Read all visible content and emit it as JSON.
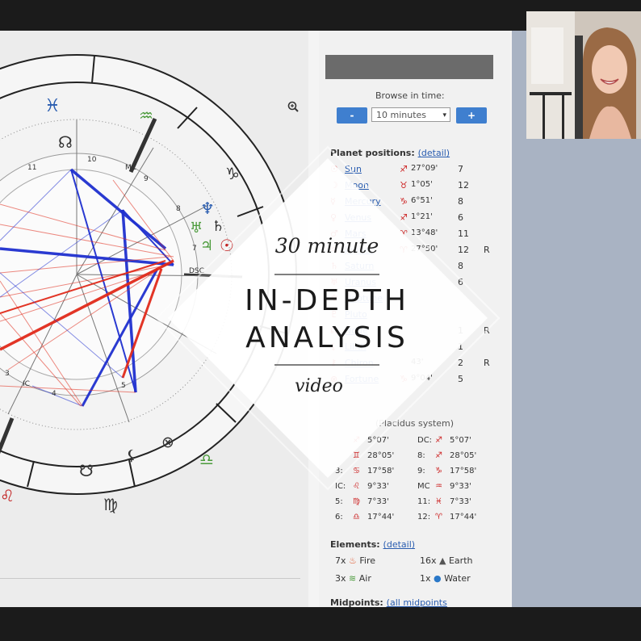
{
  "overlay": {
    "top_script": "30 minute",
    "headline_line1": "IN-DEPTH",
    "headline_line2": "ANALYSIS",
    "bottom_script": "video"
  },
  "panel": {
    "browse_label": "Browse in time:",
    "minus_label": "-",
    "plus_label": "+",
    "interval_value": "10 minutes",
    "planet_title": "Planet positions:",
    "planet_detail": "(detail)",
    "planets": [
      {
        "glyph": "☉",
        "name": "Sun",
        "sign": "♐",
        "degree": "27°09'",
        "house": "7",
        "retro": ""
      },
      {
        "glyph": "☽",
        "name": "Moon",
        "sign": "♉",
        "degree": "1°05'",
        "house": "12",
        "retro": ""
      },
      {
        "glyph": "☿",
        "name": "Mercury",
        "sign": "♑",
        "degree": "6°51'",
        "house": "8",
        "retro": ""
      },
      {
        "glyph": "♀",
        "name": "Venus",
        "sign": "♐",
        "degree": "1°21'",
        "house": "6",
        "retro": ""
      },
      {
        "glyph": "♂",
        "name": "Mars",
        "sign": "♈",
        "degree": "13°48'",
        "house": "11",
        "retro": ""
      },
      {
        "glyph": "♃",
        "name": "Jupiter",
        "sign": "♈",
        "degree": "27°50'",
        "house": "12",
        "retro": "R"
      },
      {
        "glyph": "♄",
        "name": "Saturn",
        "sign": "",
        "degree": "",
        "house": "8",
        "retro": ""
      },
      {
        "glyph": "♅",
        "name": "Uranus",
        "sign": "",
        "degree": "",
        "house": "6",
        "retro": ""
      },
      {
        "glyph": "♆",
        "name": "Neptune",
        "sign": "",
        "degree": "",
        "house": "",
        "retro": ""
      },
      {
        "glyph": "♇",
        "name": "Pluto",
        "sign": "",
        "degree": "",
        "house": "",
        "retro": ""
      },
      {
        "glyph": "☊",
        "name": "Node",
        "sign": "",
        "degree": "",
        "house": "1",
        "retro": "R"
      },
      {
        "glyph": "⚸",
        "name": "Lilith",
        "sign": "",
        "degree": "",
        "house": "1",
        "retro": ""
      },
      {
        "glyph": "⚷",
        "name": "Chiron",
        "sign": "",
        "degree": "43'",
        "house": "2",
        "retro": "R"
      },
      {
        "glyph": "⊗",
        "name": "Fortune",
        "sign": "♑",
        "degree": "9°04'",
        "house": "5",
        "retro": ""
      }
    ],
    "houses_title": "(Placidus system)",
    "houses": [
      {
        "l": "",
        "ls": "♐",
        "ld": "5°07'",
        "r": "DC:",
        "rs": "♐",
        "rd": "5°07'"
      },
      {
        "l": "",
        "ls": "♊",
        "ld": "28°05'",
        "r": "8:",
        "rs": "♐",
        "rd": "28°05'"
      },
      {
        "l": "3:",
        "ls": "♋",
        "ld": "17°58'",
        "r": "9:",
        "rs": "♑",
        "rd": "17°58'"
      },
      {
        "l": "IC:",
        "ls": "♌",
        "ld": "9°33'",
        "r": "MC",
        "rs": "♒",
        "rd": "9°33'"
      },
      {
        "l": "5:",
        "ls": "♍",
        "ld": "7°33'",
        "r": "11:",
        "rs": "♓",
        "rd": "7°33'"
      },
      {
        "l": "6:",
        "ls": "♎",
        "ld": "17°44'",
        "r": "12:",
        "rs": "♈",
        "rd": "17°44'"
      }
    ],
    "elements_title": "Elements:",
    "elements_detail": "(detail)",
    "elements": [
      {
        "count": "7x",
        "name": "Fire",
        "icon": "flame-icon",
        "color": "#e0552a"
      },
      {
        "count": "16x",
        "name": "Earth",
        "icon": "rock-icon",
        "color": "#555555"
      },
      {
        "count": "3x",
        "name": "Air",
        "icon": "wind-icon",
        "color": "#4a9a3a"
      },
      {
        "count": "1x",
        "name": "Water",
        "icon": "drop-icon",
        "color": "#2a78c8"
      }
    ],
    "midpoints_title": "Midpoints:",
    "midpoints_link": "(all midpoints"
  },
  "wheel": {
    "zodiac_labels": [
      {
        "glyph": "♓",
        "color": "#2a5db0"
      },
      {
        "glyph": "♒",
        "color": "#4a9a3a"
      },
      {
        "glyph": "♑",
        "color": "#333333"
      },
      {
        "glyph": "♎",
        "color": "#4a9a3a"
      },
      {
        "glyph": "♍",
        "color": "#333333"
      },
      {
        "glyph": "♌",
        "color": "#c22222"
      }
    ],
    "house_numbers": [
      "11",
      "10",
      "9",
      "8",
      "7",
      "3",
      "4",
      "5"
    ],
    "mc_label": "MC",
    "ic_label": "IC",
    "dsc_label": "DSC",
    "node_glyph": "☊",
    "south_node_glyph": "☋",
    "fortune_glyph": "⊗",
    "lilith_glyph": "⚸",
    "neptune_glyph": "♆",
    "uranus_glyph": "♅",
    "jupiter_glyph": "♃",
    "sun_glyph": "☉",
    "saturn_glyph": "♄"
  },
  "colors": {
    "accent_blue": "#3f7fcf",
    "aspect_red": "#e02a1a",
    "aspect_blue": "#1f2fcf"
  }
}
